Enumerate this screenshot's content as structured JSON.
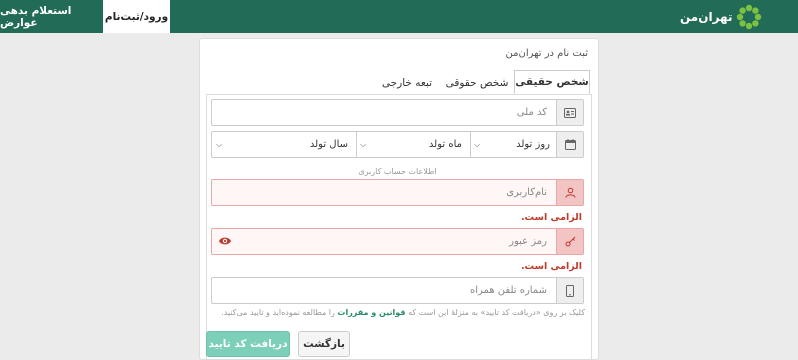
{
  "header": {
    "logo_text": "تهران‌من",
    "nav": {
      "login": "ورود/ثبت‌نام",
      "inquiry": "استعلام بدهی عوارض"
    }
  },
  "card": {
    "title": "ثبت نام در تهران‌من",
    "tabs": [
      "شخص حقیقی",
      "شخص حقوقی",
      "تبعه خارجی"
    ]
  },
  "form": {
    "national_code_placeholder": "کد ملی",
    "birth_day": "روز تولد",
    "birth_month": "ماه تولد",
    "birth_year": "سال تولد",
    "account_section_label": "اطلاعات حساب کاربری",
    "username_placeholder": "نام‌کاربری",
    "username_error": "الزامی است.",
    "password_placeholder": "رمز عبور",
    "password_error": "الزامی است.",
    "phone_placeholder": "شماره تلفن همراه",
    "terms_before": "کلیک بر روی «دریافت کد تایید» به منزلهٔ این است که",
    "terms_link": "قوانین و مقررات",
    "terms_after": "را مطالعه نموده‌اید و تایید می‌کنید."
  },
  "buttons": {
    "back": "بازگشت",
    "submit": "دریافت کد تایید"
  },
  "colors": {
    "header_bg": "#226b57",
    "error": "#c0392b",
    "submit_bg": "#7ccfb9",
    "link": "#2a8a6e"
  }
}
